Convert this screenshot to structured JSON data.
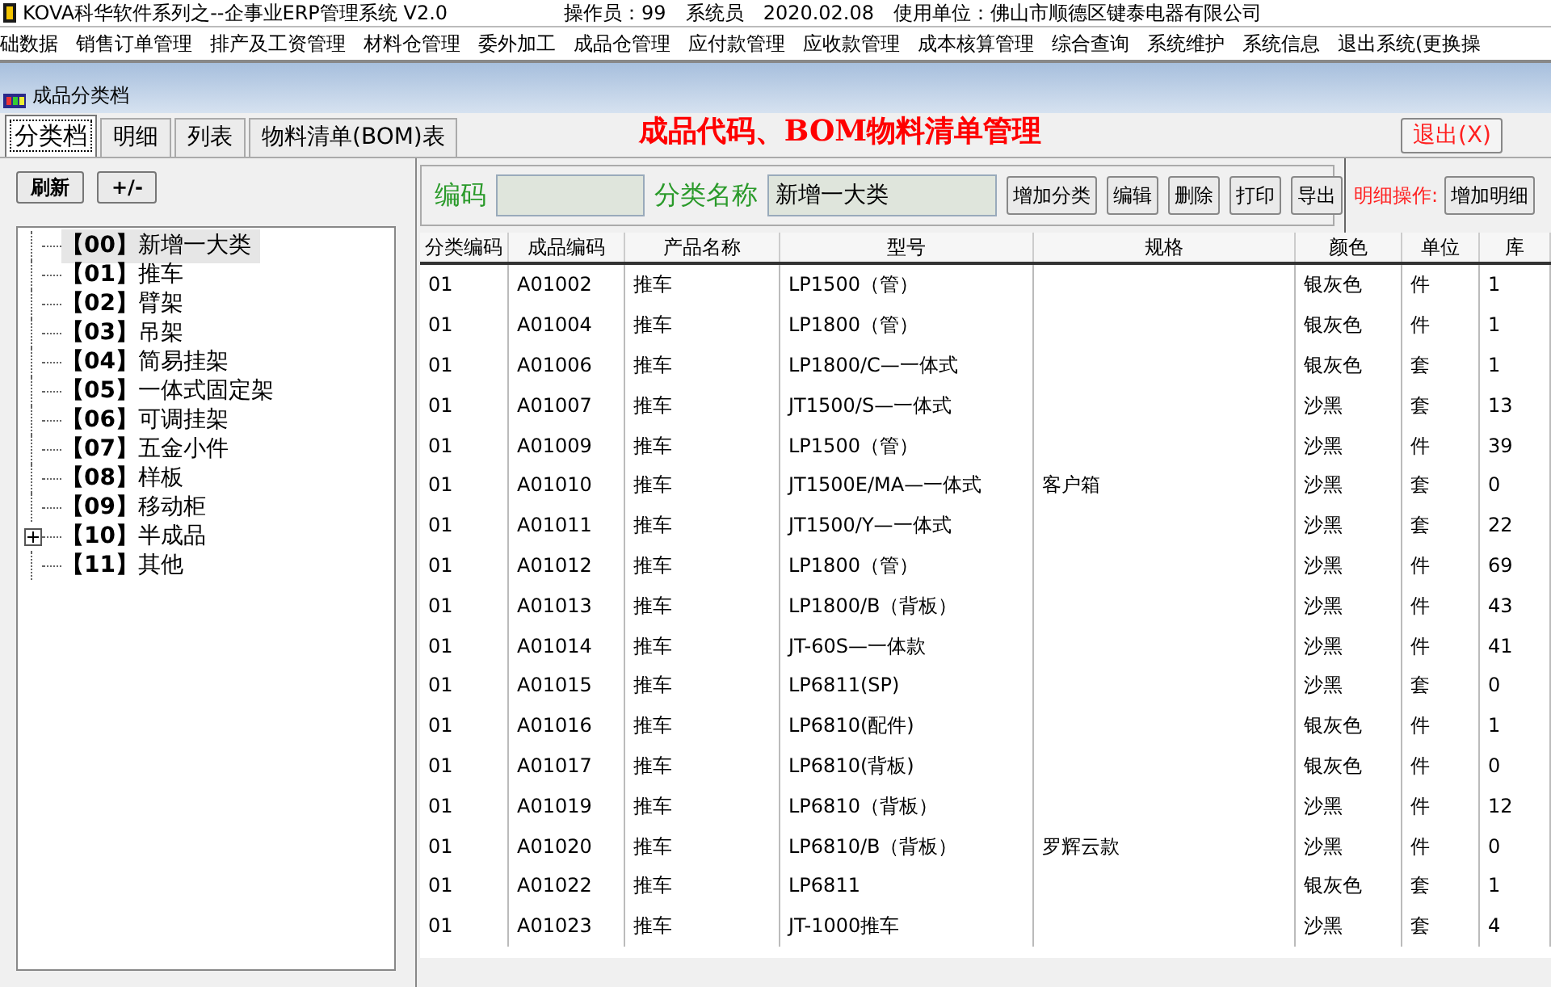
{
  "window": {
    "title": "KOVA科华软件系列之--企事业ERP管理系统 V2.0",
    "operator": "操作员：99",
    "role": "系统员",
    "date": "2020.02.08",
    "company": "使用单位：佛山市顺德区键泰电器有限公司"
  },
  "menu": [
    "础数据",
    "销售订单管理",
    "排产及工资管理",
    "材料仓管理",
    "委外加工",
    "成品仓管理",
    "应付款管理",
    "应收款管理",
    "成本核算管理",
    "综合查询",
    "系统维护",
    "系统信息",
    "退出系统(更换操"
  ],
  "form_title": "成品分类档",
  "tabs": [
    {
      "label": "分类档",
      "selected": true
    },
    {
      "label": "明细",
      "selected": false
    },
    {
      "label": "列表",
      "selected": false
    },
    {
      "label": "物料清单(BOM)表",
      "selected": false
    }
  ],
  "heading": "成品代码、BOM物料清单管理",
  "exit_button": "退出(X)",
  "tree_buttons": [
    "刷新",
    "+/-"
  ],
  "tree": [
    {
      "code": "【00】",
      "name": "新增一大类",
      "selected": true,
      "expandable": false
    },
    {
      "code": "【01】",
      "name": "推车",
      "selected": false,
      "expandable": false
    },
    {
      "code": "【02】",
      "name": "臂架",
      "selected": false,
      "expandable": false
    },
    {
      "code": "【03】",
      "name": "吊架",
      "selected": false,
      "expandable": false
    },
    {
      "code": "【04】",
      "name": "简易挂架",
      "selected": false,
      "expandable": false
    },
    {
      "code": "【05】",
      "name": "一体式固定架",
      "selected": false,
      "expandable": false
    },
    {
      "code": "【06】",
      "name": "可调挂架",
      "selected": false,
      "expandable": false
    },
    {
      "code": "【07】",
      "name": "五金小件",
      "selected": false,
      "expandable": false
    },
    {
      "code": "【08】",
      "name": "样板",
      "selected": false,
      "expandable": false
    },
    {
      "code": "【09】",
      "name": "移动柜",
      "selected": false,
      "expandable": false
    },
    {
      "code": "【10】",
      "name": "半成品",
      "selected": false,
      "expandable": true
    },
    {
      "code": "【11】",
      "name": "其他",
      "selected": false,
      "expandable": false
    }
  ],
  "fields": [
    {
      "label": "编码"
    },
    {
      "label": "分类名称",
      "value": "新增一大类"
    }
  ],
  "actions": [
    "增加分类",
    "编辑",
    "删除",
    "打印",
    "导出"
  ],
  "detail_label": "明细操作:",
  "detail_button": "增加明细",
  "table": {
    "columns": [
      "分类编码",
      "成品编码",
      "产品名称",
      "型号",
      "规格",
      "颜色",
      "单位",
      "库"
    ],
    "rows": [
      [
        "01",
        "A01002",
        "推车",
        "LP1500（管）",
        "",
        "银灰色",
        "件",
        "1"
      ],
      [
        "01",
        "A01004",
        "推车",
        "LP1800（管）",
        "",
        "银灰色",
        "件",
        "1"
      ],
      [
        "01",
        "A01006",
        "推车",
        "LP1800/C—一体式",
        "",
        "银灰色",
        "套",
        "1"
      ],
      [
        "01",
        "A01007",
        "推车",
        "JT1500/S—一体式",
        "",
        "沙黑",
        "套",
        "13"
      ],
      [
        "01",
        "A01009",
        "推车",
        "LP1500（管）",
        "",
        "沙黑",
        "件",
        "39"
      ],
      [
        "01",
        "A01010",
        "推车",
        "JT1500E/MA—一体式",
        "客户箱",
        "沙黑",
        "套",
        "0"
      ],
      [
        "01",
        "A01011",
        "推车",
        "JT1500/Y—一体式",
        "",
        "沙黑",
        "套",
        "22"
      ],
      [
        "01",
        "A01012",
        "推车",
        "LP1800（管）",
        "",
        "沙黑",
        "件",
        "69"
      ],
      [
        "01",
        "A01013",
        "推车",
        "LP1800/B（背板）",
        "",
        "沙黑",
        "件",
        "43"
      ],
      [
        "01",
        "A01014",
        "推车",
        "JT-60S—一体款",
        "",
        "沙黑",
        "件",
        "41"
      ],
      [
        "01",
        "A01015",
        "推车",
        "LP6811(SP)",
        "",
        "沙黑",
        "套",
        "0"
      ],
      [
        "01",
        "A01016",
        "推车",
        "LP6810(配件)",
        "",
        "银灰色",
        "件",
        "1"
      ],
      [
        "01",
        "A01017",
        "推车",
        "LP6810(背板)",
        "",
        "银灰色",
        "件",
        "0"
      ],
      [
        "01",
        "A01019",
        "推车",
        "LP6810（背板）",
        "",
        "沙黑",
        "件",
        "12"
      ],
      [
        "01",
        "A01020",
        "推车",
        "LP6810/B（背板）",
        "罗辉云款",
        "沙黑",
        "件",
        "0"
      ],
      [
        "01",
        "A01022",
        "推车",
        "LP6811",
        "",
        "银灰色",
        "套",
        "1"
      ],
      [
        "01",
        "A01023",
        "推车",
        "JT-1000推车",
        "",
        "沙黑",
        "套",
        "4"
      ]
    ]
  }
}
